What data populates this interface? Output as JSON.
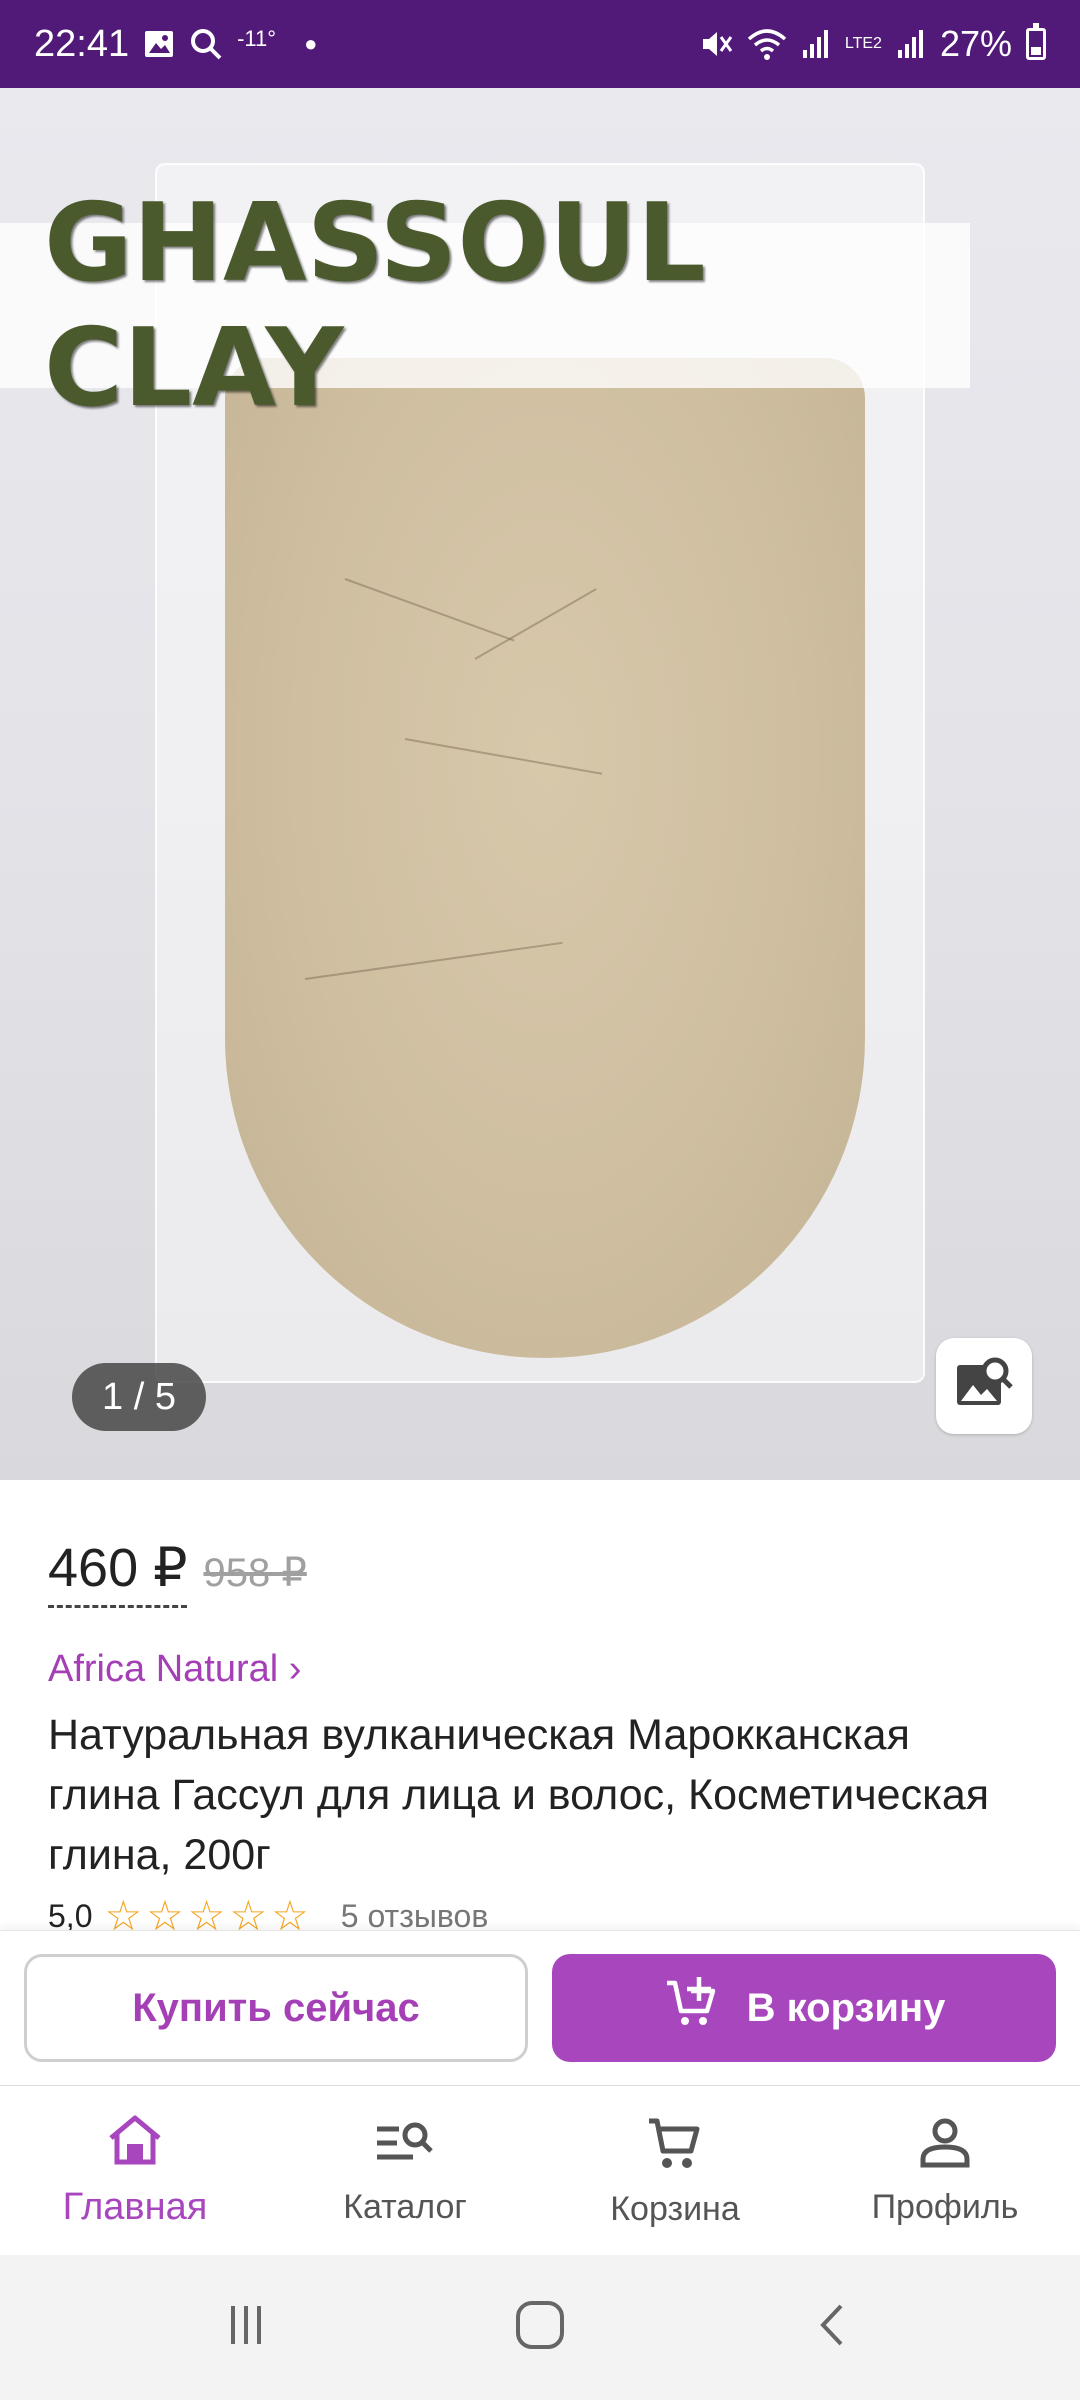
{
  "status_bar": {
    "time": "22:41",
    "temperature": "-11°",
    "network_label": "LTE2",
    "battery": "27%",
    "icons": [
      "image-icon",
      "search-icon",
      "mute-icon",
      "wifi-icon",
      "signal-icon",
      "signal-icon",
      "battery-icon"
    ]
  },
  "gallery": {
    "banner_text": "GHASSOUL CLAY",
    "counter": "1 / 5",
    "search_icon": "image-search-icon"
  },
  "product": {
    "price": "460 ₽",
    "old_price": "958 ₽",
    "seller": "Africa Natural ›",
    "title": "Натуральная вулканическая Марокканская глина Гассул для лица и волос, Косметическая глина, 200г",
    "rating": "5,0",
    "stars": 5,
    "reviews": "5 отзывов"
  },
  "actions": {
    "buy_now": "Купить сейчас",
    "add_to_cart": "В корзину"
  },
  "bottom_nav": {
    "items": [
      {
        "label": "Главная",
        "icon": "home-icon",
        "active": true
      },
      {
        "label": "Каталог",
        "icon": "catalog-search-icon",
        "active": false
      },
      {
        "label": "Корзина",
        "icon": "cart-icon",
        "active": false
      },
      {
        "label": "Профиль",
        "icon": "profile-icon",
        "active": false
      }
    ]
  },
  "colors": {
    "status_bar": "#521a78",
    "accent": "#a846bd",
    "star": "#f5a623"
  }
}
